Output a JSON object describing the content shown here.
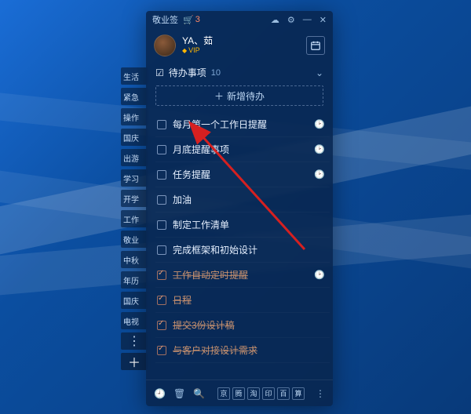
{
  "titlebar": {
    "app_name": "敬业签",
    "cart_count": "3"
  },
  "profile": {
    "username": "YA、茹",
    "vip_label": "VIP"
  },
  "section": {
    "title": "待办事项",
    "count": "10",
    "add_label": "新增待办"
  },
  "items": [
    {
      "text": "每月第一个工作日提醒",
      "done": false,
      "has_clock": true
    },
    {
      "text": "月底提醒事项",
      "done": false,
      "has_clock": true
    },
    {
      "text": "任务提醒",
      "done": false,
      "has_clock": true
    },
    {
      "text": "加油",
      "done": false,
      "has_clock": false
    },
    {
      "text": "制定工作清单",
      "done": false,
      "has_clock": false
    },
    {
      "text": "完成框架和初始设计",
      "done": false,
      "has_clock": false
    },
    {
      "text": "工作自动定时提醒",
      "done": true,
      "has_clock": true
    },
    {
      "text": "日程",
      "done": true,
      "has_clock": false
    },
    {
      "text": "提交3份设计稿",
      "done": true,
      "has_clock": false
    },
    {
      "text": "与客户对接设计需求",
      "done": true,
      "has_clock": false
    }
  ],
  "sidebar": [
    "生活",
    "紧急",
    "操作",
    "国庆",
    "出游",
    "学习",
    "开学",
    "工作",
    "敬业",
    "中秋",
    "年历",
    "国庆",
    "电视"
  ],
  "footer_squares": [
    "京",
    "腾",
    "淘",
    "印",
    "百",
    "算"
  ]
}
